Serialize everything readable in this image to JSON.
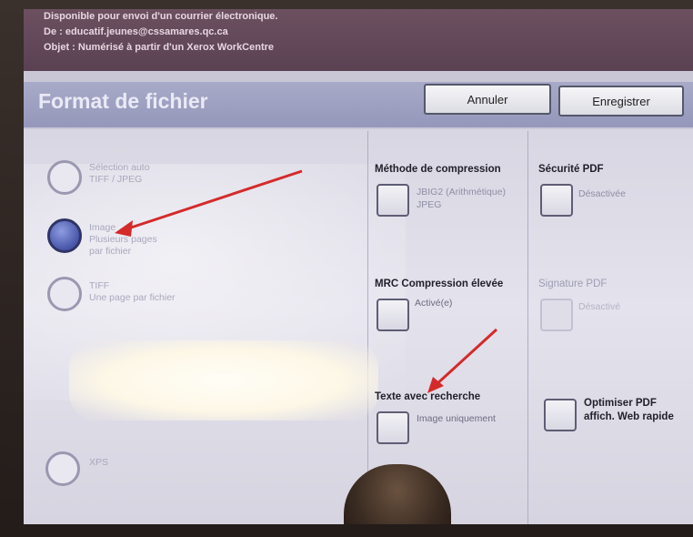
{
  "header": {
    "line1": "Disponible pour envoi d'un courrier électronique.",
    "line2": "De : educatif.jeunes@cssamares.qc.ca",
    "line3": "Objet : Numérisé à partir d'un Xerox WorkCentre"
  },
  "titlebar": {
    "title": "Format de fichier",
    "cancel_label": "Annuler",
    "save_label": "Enregistrer"
  },
  "format_options": [
    {
      "line1": "Sélection auto",
      "line2": "TIFF / JPEG",
      "line3": ""
    },
    {
      "line1": "Image",
      "line2": "Plusieurs pages",
      "line3": "par fichier"
    },
    {
      "line1": "TIFF",
      "line2": "Une page par fichier",
      "line3": ""
    },
    {
      "line1": "XPS",
      "line2": "",
      "line3": ""
    }
  ],
  "settings": {
    "compression": {
      "label": "Méthode de compression",
      "value1": "JBIG2 (Arithmétique)",
      "value2": "JPEG"
    },
    "pdf_security": {
      "label": "Sécurité PDF",
      "value": "Désactivée"
    },
    "mrc": {
      "label": "MRC Compression élevée",
      "value": "Activé(e)"
    },
    "pdf_signature": {
      "label": "Signature PDF",
      "value": "Désactivé"
    },
    "searchable_text": {
      "label": "Texte avec recherche",
      "value": "Image uniquement"
    },
    "optimize_pdf": {
      "line1": "Optimiser PDF",
      "line2": "affich. Web rapide"
    }
  },
  "colors": {
    "header": "#5a4152",
    "titlebar": "#9597bb",
    "selected_radio": "#4756a8",
    "arrow": "#d42a2a"
  }
}
